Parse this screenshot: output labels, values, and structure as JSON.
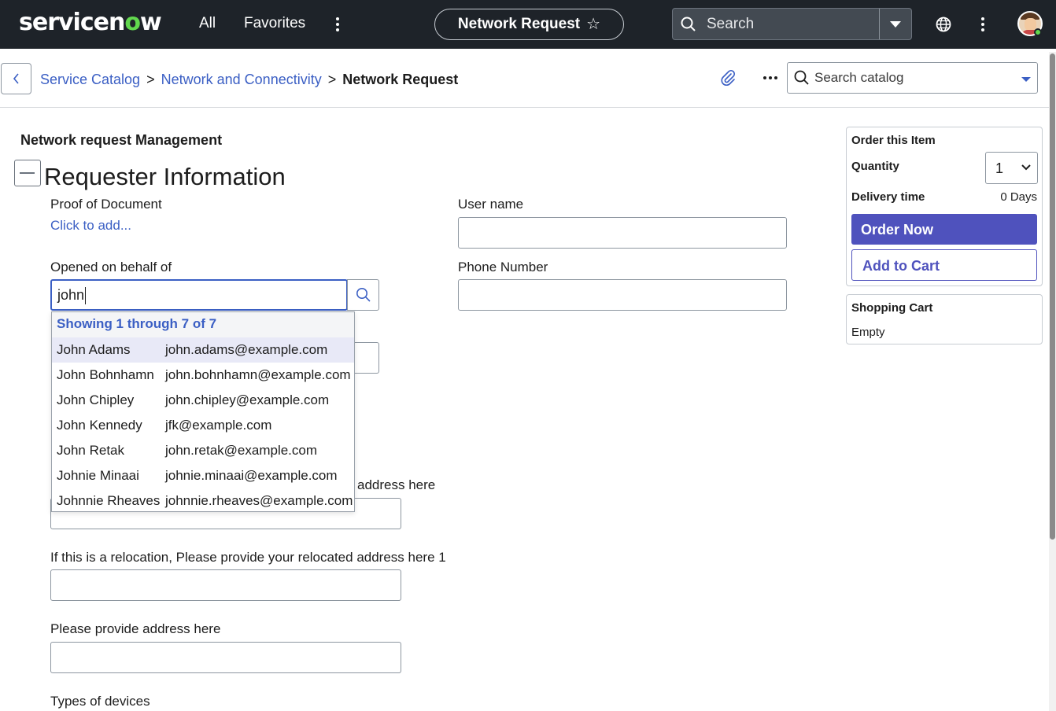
{
  "topbar": {
    "logo_text": "servicenow",
    "nav": {
      "all": "All",
      "favorites": "Favorites"
    },
    "context_title": "Network Request",
    "search_placeholder": "Search",
    "accent_color": "#62d84e",
    "bar_color": "#1e2329"
  },
  "breadcrumb": {
    "items": [
      "Service Catalog",
      "Network and Connectivity"
    ],
    "separator": ">",
    "current": "Network Request"
  },
  "catalog_search": {
    "placeholder": "Search catalog"
  },
  "form": {
    "heading": "Network request Management",
    "section_title": "Requester Information",
    "proof_label": "Proof of Document",
    "proof_link": "Click to add...",
    "user_name_label": "User name",
    "user_name_value": "",
    "behalf_label": "Opened on behalf of",
    "behalf_value": "john",
    "phone_label": "Phone Number",
    "phone_value": "",
    "address_tail_label": "address here",
    "relocation_label": "If this is a relocation, Please provide your relocated address here 1",
    "address_label": "Please provide address here",
    "devices_label": "Types of devices"
  },
  "autocomplete": {
    "summary": "Showing 1 through 7 of 7",
    "active_index": 0,
    "results": [
      {
        "name": "John Adams",
        "email": "john.adams@example.com"
      },
      {
        "name": "John Bohnhamn",
        "email": "john.bohnhamn@example.com"
      },
      {
        "name": "John Chipley",
        "email": "john.chipley@example.com"
      },
      {
        "name": "John Kennedy",
        "email": "jfk@example.com"
      },
      {
        "name": "John Retak",
        "email": "john.retak@example.com"
      },
      {
        "name": "Johnie Minaai",
        "email": "johnie.minaai@example.com"
      },
      {
        "name": "Johnnie Rheaves",
        "email": "johnnie.rheaves@example.com"
      }
    ]
  },
  "order": {
    "title": "Order this Item",
    "quantity_label": "Quantity",
    "quantity_value": "1",
    "delivery_label": "Delivery time",
    "delivery_value": "0 Days",
    "order_now": "Order Now",
    "add_to_cart": "Add to Cart",
    "button_color": "#4f52bd"
  },
  "cart": {
    "title": "Shopping Cart",
    "status": "Empty"
  },
  "icons": {
    "more": "vertical-dots-icon",
    "star": "star-icon",
    "search": "search-icon",
    "globe": "globe-icon",
    "attachment": "paperclip-icon",
    "back": "chevron-left-icon"
  }
}
